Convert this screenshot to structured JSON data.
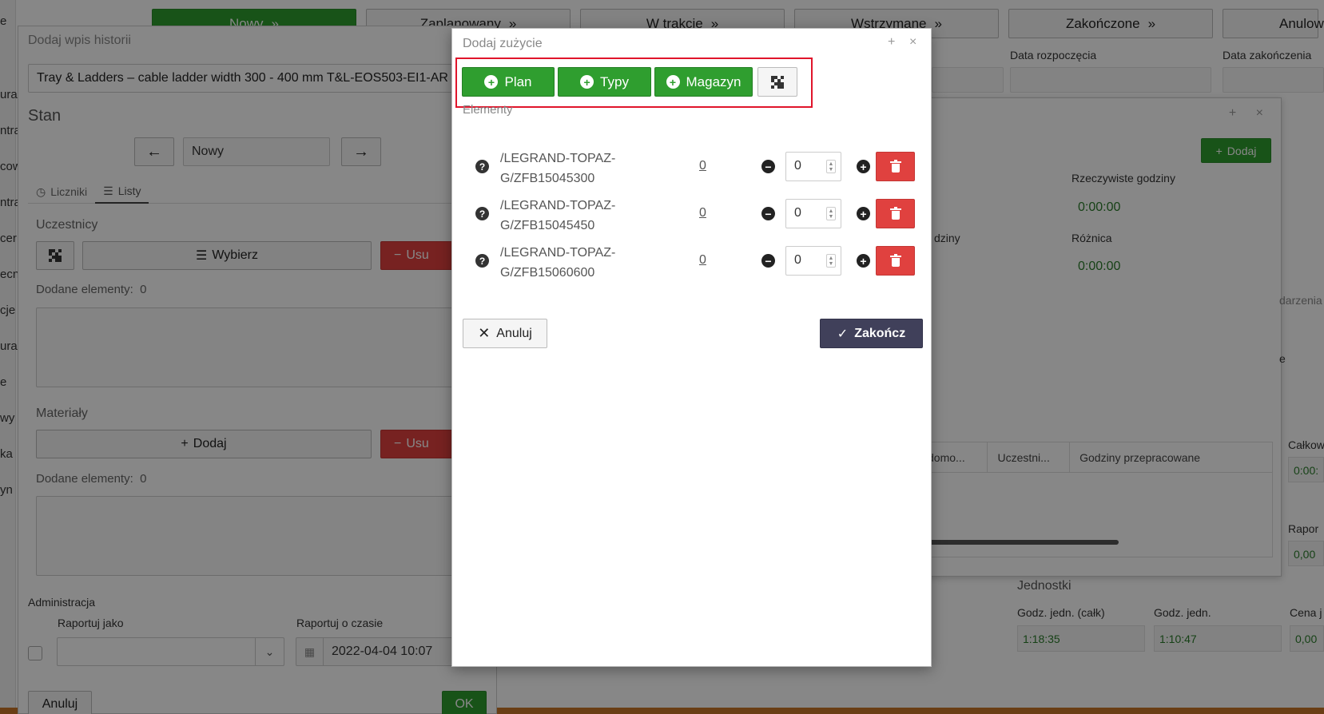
{
  "status_bar": [
    {
      "label": "Nowy",
      "active": true
    },
    {
      "label": "Zaplanowany",
      "active": false
    },
    {
      "label": "W trakcie",
      "active": false
    },
    {
      "label": "Wstrzymane",
      "active": false
    },
    {
      "label": "Zakończone",
      "active": false
    },
    {
      "label": "Anulow",
      "active": false
    }
  ],
  "background": {
    "start_date_label": "Data rozpoczęcia",
    "end_date_label": "Data zakończenia",
    "add_label": "Dodaj",
    "actual_hours_label": "Rzeczywiste godziny",
    "actual_hours_value": "0:00:00",
    "difference_label": "Różnica",
    "difference_value": "0:00:00",
    "hours_fragment": "dziny",
    "events_fragment": "darzenia",
    "e_fragment": "e",
    "table_headers": [
      "...",
      "Wiadomo...",
      "Uczestni...",
      "Godziny przepracowane"
    ],
    "right_total_label": "Całkow",
    "right_total_value": "0:00:",
    "right_report_label": "Rapor",
    "right_report_value": "0,00",
    "units_title": "Jednostki",
    "unit_labels": [
      "Godz. jedn. (całk)",
      "Godz. jedn.",
      "Cena j"
    ],
    "unit_values": [
      "1:18:35",
      "1:10:47",
      "0,00"
    ],
    "left_strip_fragments": [
      "e",
      "ura",
      "ntra",
      "cow",
      "ntra",
      "cer",
      "ecn",
      "cje",
      "ura",
      "e",
      "wy",
      "ka",
      "yn"
    ]
  },
  "history_dialog": {
    "title": "Dodaj wpis historii",
    "product": "Tray & Ladders – cable ladder width 300 - 400 mm T&L-EOS503-EI1-AR",
    "state_label": "Stan",
    "state_value": "Nowy",
    "tabs": [
      "Liczniki",
      "Listy"
    ],
    "participants_label": "Uczestnicy",
    "choose_label": "Wybierz",
    "remove_label": "Usu",
    "added_elements_label": "Dodane elementy:",
    "participants_count": "0",
    "materials_label": "Materiały",
    "add_label": "Dodaj",
    "materials_count": "0",
    "admin_label": "Administracja",
    "report_as_label": "Raportuj jako",
    "report_time_label": "Raportuj o czasie",
    "report_time_value": "2022-04-04 10:07",
    "cancel_label": "Anuluj",
    "ok_label": "OK"
  },
  "modal": {
    "title": "Dodaj zużycie",
    "buttons": {
      "plan": "Plan",
      "types": "Typy",
      "warehouse": "Magazyn"
    },
    "elements_label": "Elementy",
    "rows": [
      {
        "name_line1": "/LEGRAND-TOPAZ-",
        "name_line2": "G/ZFB15045300",
        "link": "0",
        "qty": "0"
      },
      {
        "name_line1": "/LEGRAND-TOPAZ-",
        "name_line2": "G/ZFB15045450",
        "link": "0",
        "qty": "0"
      },
      {
        "name_line1": "/LEGRAND-TOPAZ-",
        "name_line2": "G/ZFB15060600",
        "link": "0",
        "qty": "0"
      }
    ],
    "cancel_label": "Anuluj",
    "finish_label": "Zakończ"
  },
  "colors": {
    "green": "#2f9e2f",
    "red": "#e0413f",
    "dark_button": "#40405a",
    "highlight": "#e0152b"
  }
}
